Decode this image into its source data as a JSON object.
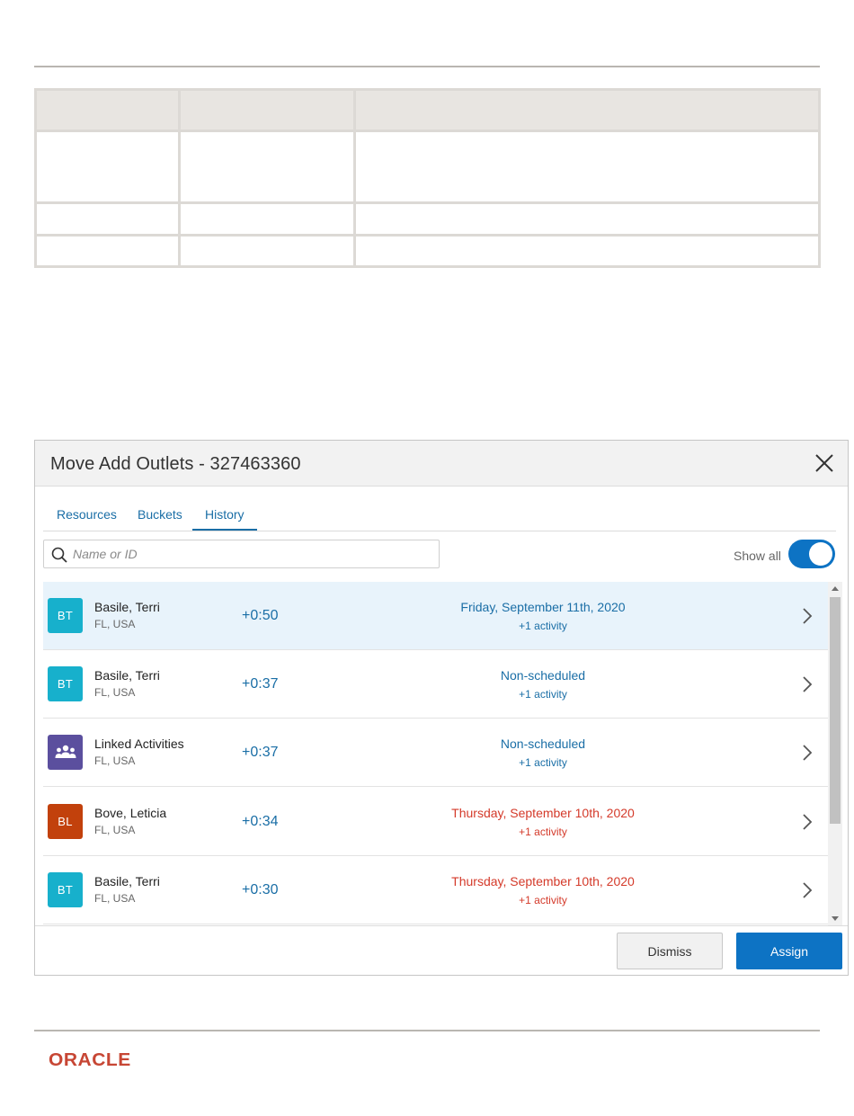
{
  "colors": {
    "accent": "#0d73c4",
    "link": "#1a6ea6",
    "late": "#d43a2a",
    "selected_row": "#e8f3fb",
    "oracle_red": "#c74634"
  },
  "dialog": {
    "title": "Move Add Outlets - 327463360",
    "tabs": [
      {
        "label": "Resources"
      },
      {
        "label": "Buckets"
      },
      {
        "label": "History",
        "active": true
      }
    ],
    "search": {
      "placeholder": "Name or ID",
      "value": ""
    },
    "show_all": {
      "label": "Show all",
      "on": true
    },
    "rows": [
      {
        "initials": "BT",
        "avatar_color": "#17b0cc",
        "name": "Basile, Terri",
        "location": "FL, USA",
        "time": "+0:50",
        "date": "Friday, September 11th, 2020",
        "date_late": false,
        "sub": "+1 activity",
        "selected": true
      },
      {
        "initials": "BT",
        "avatar_color": "#17b0cc",
        "name": "Basile, Terri",
        "location": "FL, USA",
        "time": "+0:37",
        "date": "Non-scheduled",
        "date_late": false,
        "sub": "+1 activity",
        "selected": false
      },
      {
        "initials": "",
        "icon": "group-icon",
        "avatar_color": "#5b4f9e",
        "name": "Linked Activities",
        "location": "FL, USA",
        "time": "+0:37",
        "date": "Non-scheduled",
        "date_late": false,
        "sub": "+1 activity",
        "selected": false
      },
      {
        "initials": "BL",
        "avatar_color": "#c2410c",
        "name": "Bove, Leticia",
        "location": "FL, USA",
        "time": "+0:34",
        "date": "Thursday, September 10th, 2020",
        "date_late": true,
        "sub": "+1 activity",
        "selected": false
      },
      {
        "initials": "BT",
        "avatar_color": "#17b0cc",
        "name": "Basile, Terri",
        "location": "FL, USA",
        "time": "+0:30",
        "date": "Thursday, September 10th, 2020",
        "date_late": true,
        "sub": "+1 activity",
        "selected": false
      }
    ],
    "buttons": {
      "dismiss": "Dismiss",
      "assign": "Assign"
    }
  },
  "footer": {
    "logo": "ORACLE"
  }
}
